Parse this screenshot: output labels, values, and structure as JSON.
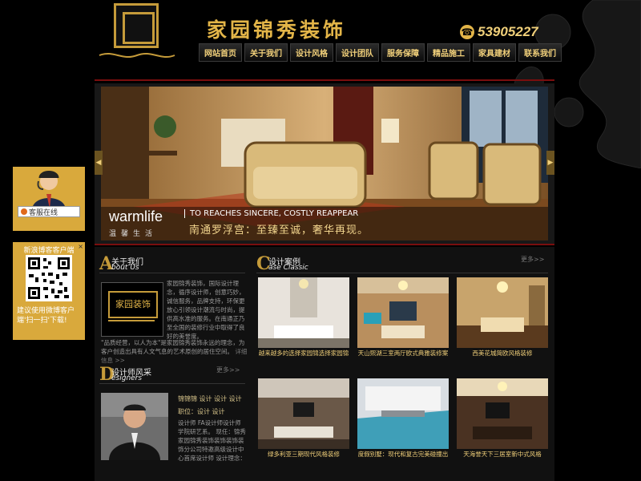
{
  "brand": {
    "name": "家园锦秀装饰"
  },
  "phone": {
    "number": "53905227"
  },
  "nav": {
    "items": [
      "网站首页",
      "关于我们",
      "设计风格",
      "设计团队",
      "服务保障",
      "精品施工",
      "家具建材",
      "联系我们"
    ]
  },
  "banner": {
    "en": "warmlife",
    "cn_small": "温馨生活",
    "slogan": "TO REACHES SINCERE, COSTLY REAPPEAR",
    "cn": "南通罗浮宫：至臻至诚，奢华再现。"
  },
  "kefu": {
    "label": "客服在线"
  },
  "qr": {
    "title": "新浪博客客户端",
    "close": "×",
    "text": "建议使用微博客户端'扫一扫'下载!"
  },
  "about": {
    "letter": "A",
    "cn": "关于我们",
    "en": "bout Us",
    "logo_text": "家园装饰",
    "text": "家园锦秀装饰，国际设计理念，循序设计师，创意巧妙，诚信服务，品牌支持，环保更放心引领设计潮流与时尚，提供高水准的服务。在南通正乃至全国的装修行业中取得了良好的美誉度。",
    "text2": "\"品质经营，以人为本\"是家园锦秀装饰永远的理念，为客户创造出具有人文气息的艺术原创的居住空间。",
    "detail": "详细信息 >>"
  },
  "designers": {
    "letter": "D",
    "cn": "设计师风采",
    "en": "esigners",
    "more": "更多>>",
    "name": "锦锦锦  设计 设计 设计",
    "role": "职位：设计 设计",
    "desc": "设计师 FA设计师设计师学院研艺系。 现任：锦秀家园锦秀装饰装饰装饰装饰分公司特邀高级设计中心首席设计师 设计理念："
  },
  "cases": {
    "letter": "C",
    "cn": "设计案例",
    "en": "ase Classic",
    "more": "更多>>",
    "items": [
      {
        "label": "越来越多的选择家园锦选择家园锦"
      },
      {
        "label": "天山熙湖三室两厅欧式典雅装修案"
      },
      {
        "label": "西美花城简欧风格装修"
      },
      {
        "label": "绿多利亚三期现代风格装修"
      },
      {
        "label": "度假别墅：现代和复古完美碰撞出"
      },
      {
        "label": "天海誉天下三居室新中式风格"
      }
    ]
  },
  "colors": {
    "accent": "#c59b3a",
    "gold_text": "#f1d07a",
    "red_rule": "#7a0e0e",
    "panel": "#d9a93c"
  }
}
